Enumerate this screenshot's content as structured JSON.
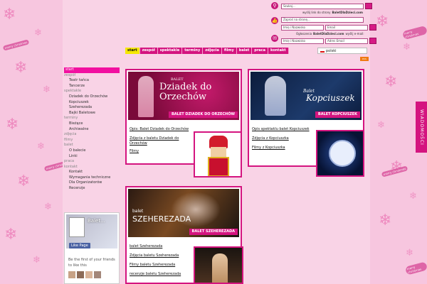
{
  "header": {
    "search_placeholder": "Szukaj...",
    "send_link_text_prefix": "wyślij link do strony",
    "send_link_site": "BaletDlaDzieci.com",
    "invite_placeholder": "Zaproś na stronę...",
    "name_placeholder": "Imię i Nazwisko",
    "email_placeholder": "Email",
    "announce_prefix": "Ogłoszenia",
    "announce_site": "BaletDlaDzieci.com",
    "announce_suffix": "wyślij e-mail:",
    "address_placeholder": "Adres Email"
  },
  "nav": {
    "items": [
      "start",
      "zespół",
      "spektakle",
      "terminy",
      "zdjęcia",
      "filmy",
      "balet",
      "praca",
      "kontakt"
    ],
    "active": 0,
    "language": "polski",
    "rss": "RSS"
  },
  "sidebar": {
    "items": [
      {
        "label": "start",
        "kind": "on"
      },
      {
        "label": "zespół",
        "kind": "sec"
      },
      {
        "label": "Teatr tańca",
        "kind": "sub"
      },
      {
        "label": "Tancerze",
        "kind": "sub"
      },
      {
        "label": "spektakle",
        "kind": "sec"
      },
      {
        "label": "Dziadek do Orzechów",
        "kind": "sub"
      },
      {
        "label": "Kopciuszek",
        "kind": "sub"
      },
      {
        "label": "Szeherezada",
        "kind": "sub"
      },
      {
        "label": "Bajki Baletowe",
        "kind": "sub"
      },
      {
        "label": "terminy",
        "kind": "sec"
      },
      {
        "label": "Bieżące",
        "kind": "sub"
      },
      {
        "label": "Archiwalne",
        "kind": "sub"
      },
      {
        "label": "zdjęcia",
        "kind": "sec"
      },
      {
        "label": "filmy",
        "kind": "sec"
      },
      {
        "label": "balet",
        "kind": "sec"
      },
      {
        "label": "O balecie",
        "kind": "sub"
      },
      {
        "label": "Linki",
        "kind": "sub"
      },
      {
        "label": "praca",
        "kind": "sec"
      },
      {
        "label": "kontakt",
        "kind": "sec"
      },
      {
        "label": "Kontakt",
        "kind": "sub"
      },
      {
        "label": "Wymagania techniczne",
        "kind": "sub"
      },
      {
        "label": "Dla Organizatorów",
        "kind": "sub"
      },
      {
        "label": "Recenzje",
        "kind": "sub"
      }
    ]
  },
  "facebook": {
    "page_name": "Balet...",
    "like_label": "Like Page",
    "friends_text": "Be the first of your friends to like this"
  },
  "cards": {
    "dziadek": {
      "title_top": "BALET",
      "title_main": "Dziadek do Orzechów",
      "caption": "BALET DZIADEK DO ORZECHÓW",
      "links": [
        "Opis: Balet Dziadek do Orzechów",
        "Zdjęcia z baletu Dziadek do Orzechów",
        "Filmy"
      ]
    },
    "kopciuszek": {
      "title_top": "Balet",
      "title_main": "Kopciuszek",
      "caption": "BALET KOPCIUSZEK",
      "links": [
        "Opis spektaklu balet Kopciuszek",
        "Zdjęcia z Kopciuszka",
        "Filmy z Kopciuszka"
      ]
    },
    "szeherezada": {
      "title_top": "balet",
      "title_main": "SZEHEREZADA",
      "caption": "BALET SZEHEREZADA",
      "links": [
        "balet Szeherezada",
        "Zdjęcia baletu Szeherezada",
        "Filmy baletu Szeherezada",
        "recenzje baletu Szeherezada"
      ]
    }
  },
  "side_tab": "WIADOMOŚCI",
  "decor": {
    "merry": "merry christmas"
  },
  "colors": {
    "accent": "#d4147f",
    "background": "#f7c6df",
    "active_nav": "#f5e800"
  }
}
